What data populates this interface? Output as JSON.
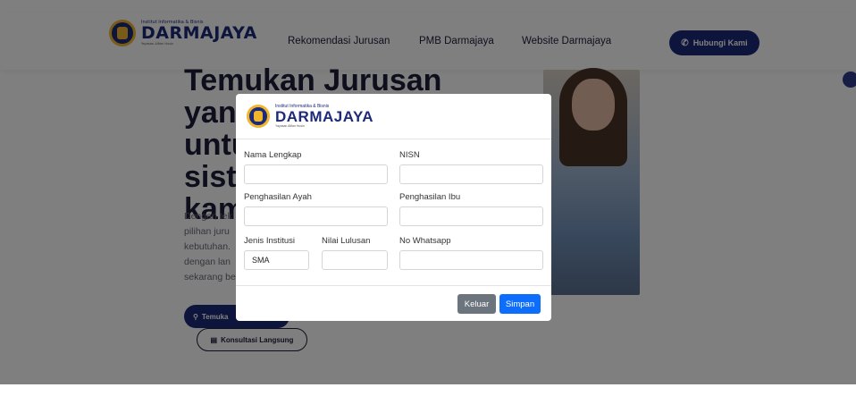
{
  "brand": {
    "subtitle": "Institut Informatika & Bisnis",
    "name": "DARMAJAYA",
    "tagline": "Yayasan Alfian Husin"
  },
  "nav": {
    "links": [
      "Rekomendasi Jurusan",
      "PMB Darmajaya",
      "Website Darmajaya"
    ],
    "contact_label": "Hubungi Kami",
    "contact_icon": "phone-icon"
  },
  "hero": {
    "title_lines": [
      "Temukan Jurusan",
      "yang",
      "untu",
      "sister",
      "kami"
    ],
    "desc_lines": [
      "Dengan tek",
      "pilihan juru",
      "kebutuhan.",
      "dengan lan",
      "sekarang be"
    ],
    "btn_primary": "Temuka",
    "btn_secondary": "Konsultasi Langsung"
  },
  "modal": {
    "brand_subtitle": "Institut Informatika & Bisnis",
    "brand_name": "DARMAJAYA",
    "brand_tagline": "Yayasan Alfian Husin",
    "fields": {
      "nama_lengkap": {
        "label": "Nama Lengkap",
        "value": ""
      },
      "nisn": {
        "label": "NISN",
        "value": ""
      },
      "penghasilan_ayah": {
        "label": "Penghasilan Ayah",
        "value": ""
      },
      "penghasilan_ibu": {
        "label": "Penghasilan Ibu",
        "value": ""
      },
      "jenis_institusi": {
        "label": "Jenis Institusi",
        "value": "SMA"
      },
      "nilai_lulusan": {
        "label": "Nilai Lulusan",
        "value": ""
      },
      "no_whatsapp": {
        "label": "No Whatsapp",
        "value": ""
      }
    },
    "btn_keluar": "Keluar",
    "btn_simpan": "Simpan"
  },
  "colors": {
    "brand_navy": "#1d2a7a",
    "brand_gold": "#f0b62c",
    "btn_secondary": "#6c757d",
    "btn_primary": "#0d6efd",
    "overlay": "rgba(0,0,0,0.5)"
  }
}
